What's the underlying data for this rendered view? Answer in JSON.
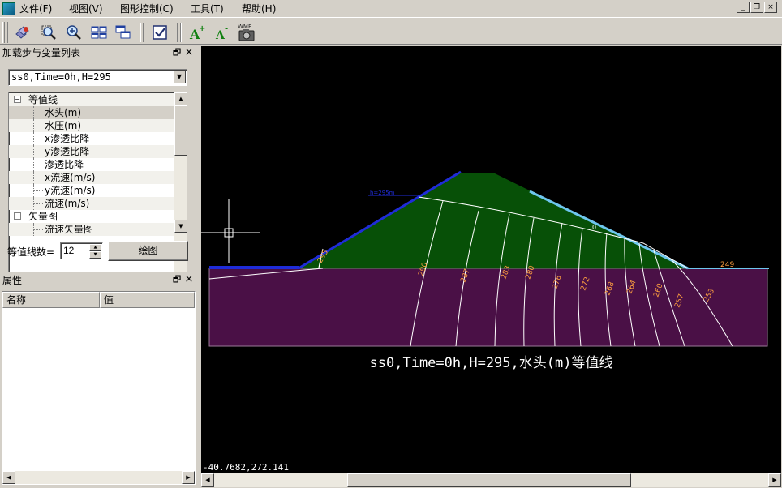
{
  "menu": {
    "items": [
      "文件(F)",
      "视图(V)",
      "图形控制(C)",
      "工具(T)",
      "帮助(H)"
    ],
    "window_buttons": [
      "_",
      "❐",
      "×"
    ]
  },
  "toolbar": {
    "buttons": [
      {
        "name": "layers-icon"
      },
      {
        "name": "zoom-window-icon"
      },
      {
        "name": "zoom-in-icon"
      },
      {
        "name": "tile-icon"
      },
      {
        "name": "cascade-icon"
      },
      {
        "name": "check-icon"
      },
      {
        "name": "font-increase-icon",
        "label": "A+"
      },
      {
        "name": "font-decrease-icon",
        "label": "A-"
      },
      {
        "name": "wmf-camera-icon",
        "label": "WMF"
      }
    ]
  },
  "load_panel": {
    "title": "加载步与变量列表",
    "selected_step": "ss0,Time=0h,H=295",
    "tree": [
      {
        "label": "等值线",
        "level": 0,
        "expanded": true
      },
      {
        "label": "水头(m)",
        "level": 1,
        "selected": true
      },
      {
        "label": "水压(m)",
        "level": 1
      },
      {
        "label": "x渗透比降",
        "level": 1
      },
      {
        "label": "y渗透比降",
        "level": 1
      },
      {
        "label": "渗透比降",
        "level": 1
      },
      {
        "label": "x流速(m/s)",
        "level": 1
      },
      {
        "label": "y流速(m/s)",
        "level": 1
      },
      {
        "label": "流速(m/s)",
        "level": 1
      },
      {
        "label": "矢量图",
        "level": 0,
        "expanded": true
      },
      {
        "label": "流速矢量图",
        "level": 1
      }
    ],
    "contour_count_label": "等值线数=",
    "contour_count": "12",
    "draw_button": "绘图"
  },
  "property_panel": {
    "title": "属性",
    "columns": [
      "名称",
      "值"
    ]
  },
  "plot": {
    "caption": "ss0,Time=0h,H=295,水头(m)等值线",
    "coord_readout": "-40.7682,272.141",
    "waterline_label": "h=295m",
    "phreatic_label": "0",
    "contour_labels": [
      "295",
      "290",
      "287",
      "283",
      "280",
      "276",
      "272",
      "268",
      "264",
      "260",
      "257",
      "253",
      "249"
    ],
    "colors": {
      "dam": "#075007",
      "foundation": "#4a1046",
      "contour": "#ffffff",
      "label": "#ffa040",
      "upstream_face": "#1f2cd8",
      "downstream_face": "#6ec6ee"
    }
  }
}
